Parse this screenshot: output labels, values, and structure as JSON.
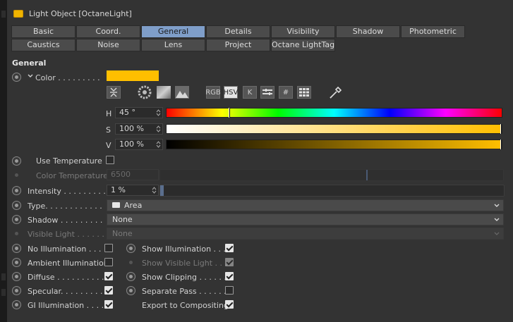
{
  "window": {
    "title": "Light Object [OctaneLight]"
  },
  "tabs": {
    "row1": [
      "Basic",
      "Coord.",
      "General",
      "Details",
      "Visibility",
      "Shadow",
      "Photometric"
    ],
    "row2": [
      "Caustics",
      "Noise",
      "Lens",
      "Project",
      "Octane LightTag"
    ],
    "active": "General"
  },
  "section": {
    "title": "General"
  },
  "color": {
    "label": "Color . . . . . . . . .",
    "swatch_hex": "#ffbf00",
    "toolbar": {
      "rgb": "RGB",
      "hsv": "HSV",
      "k": "K",
      "hash": "#"
    },
    "h": {
      "label": "H",
      "value": "45 °",
      "fraction": 0.125
    },
    "s": {
      "label": "S",
      "value": "100 %",
      "fraction": 1.0
    },
    "v": {
      "label": "V",
      "value": "100 %",
      "fraction": 1.0
    }
  },
  "temperature": {
    "use_label": "Use Temperature",
    "use_checked": false,
    "color_temp_label": "Color Temperature",
    "color_temp_value": "6500",
    "color_temp_fraction": 0.6
  },
  "intensity": {
    "label": "Intensity . . . . . . . . .",
    "value": "1 %",
    "fraction": 0.01
  },
  "type": {
    "label": "Type. . . . . . . . . . . .",
    "value": "Area"
  },
  "shadow": {
    "label": "Shadow . . . . . . . . .",
    "value": "None"
  },
  "visible_light": {
    "label": "Visible Light . . . . . .",
    "value": "None"
  },
  "checkboxes_left": [
    {
      "label": "No Illumination . . . .",
      "checked": false
    },
    {
      "label": "Ambient Illumination",
      "checked": false
    },
    {
      "label": "Diffuse . . . . . . . . . .",
      "checked": true
    },
    {
      "label": "Specular. . . . . . . . . .",
      "checked": true
    },
    {
      "label": "GI Illumination  . . . .",
      "checked": true
    }
  ],
  "checkboxes_right": [
    {
      "label": "Show Illumination . . .",
      "checked": true,
      "dim": false
    },
    {
      "label": "Show Visible Light . . .",
      "checked": true,
      "dim": true
    },
    {
      "label": "Show Clipping . . . . . .",
      "checked": true,
      "dim": false
    },
    {
      "label": "Separate Pass . . . . . .",
      "checked": false,
      "dim": false
    },
    {
      "label": "Export to Compositing",
      "checked": true,
      "dim": false
    }
  ]
}
